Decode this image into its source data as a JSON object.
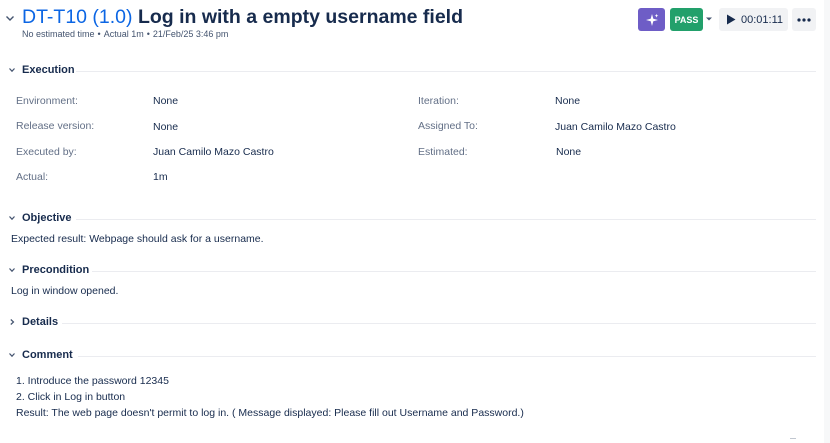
{
  "header": {
    "key": "DT-T10 (1.0)",
    "name": "Log in with a empty username field",
    "meta": {
      "estimated": "No estimated time",
      "actual": "Actual 1m",
      "date": "21/Feb/25 3:46 pm"
    },
    "status_label": "PASS",
    "timer": "00:01:11",
    "colors": {
      "ai_button": "#6e5dc6",
      "pass": "#22a06b",
      "key": "#0c66e4"
    },
    "icons": [
      "chevron-down-icon",
      "sparkle-icon",
      "caret-down-icon",
      "play-icon",
      "more-icon"
    ]
  },
  "execution": {
    "title": "Execution",
    "fields": {
      "environment": {
        "label": "Environment:",
        "value": "None"
      },
      "release": {
        "label": "Release version:",
        "value": "None"
      },
      "executed_by": {
        "label": "Executed by:",
        "value": "Juan Camilo Mazo Castro"
      },
      "actual": {
        "label": "Actual:",
        "value": "1m"
      },
      "iteration": {
        "label": "Iteration:",
        "value": "None"
      },
      "assigned_to": {
        "label": "Assigned To:",
        "value": "Juan Camilo Mazo Castro"
      },
      "estimated": {
        "label": "Estimated:",
        "value": "None"
      }
    }
  },
  "objective": {
    "title": "Objective",
    "text": "Expected result: Webpage should ask for a username."
  },
  "precondition": {
    "title": "Precondition",
    "text": "Log in window opened."
  },
  "details": {
    "title": "Details"
  },
  "comment": {
    "title": "Comment",
    "lines": [
      "1. Introduce the password 12345",
      "2. Click in Log in button",
      "Result: The web page doesn't permit to log in. ( Message displayed: Please fill out Username and Password.)"
    ]
  }
}
